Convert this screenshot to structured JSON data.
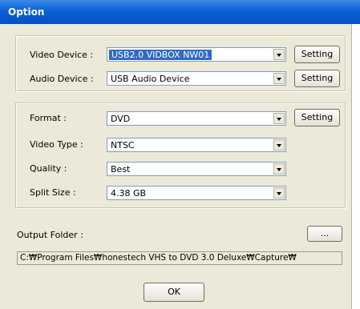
{
  "window": {
    "title": "Option"
  },
  "device": {
    "video_label": "Video Device :",
    "video_value": "USB2.0 VIDBOX NW01",
    "audio_label": "Audio Device :",
    "audio_value": "USB Audio Device",
    "setting_label": "Setting"
  },
  "encoding": {
    "format_label": "Format :",
    "format_value": "DVD",
    "video_type_label": "Video Type :",
    "video_type_value": "NTSC",
    "quality_label": "Quality :",
    "quality_value": "Best",
    "split_label": "Split Size :",
    "split_value": "4.38 GB",
    "setting_label": "Setting"
  },
  "output": {
    "label": "Output Folder :",
    "browse_label": "...",
    "path": "C:₩Program Files₩honestech VHS to DVD 3.0 Deluxe₩Capture₩"
  },
  "ok_label": "OK"
}
